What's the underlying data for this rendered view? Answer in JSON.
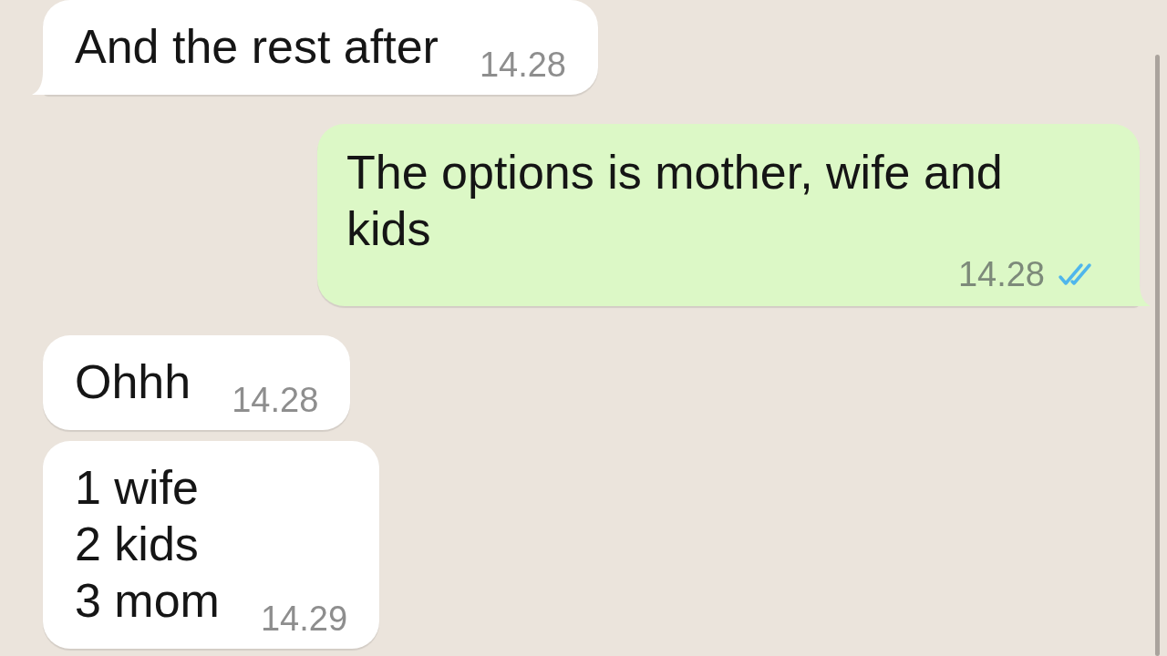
{
  "messages": [
    {
      "kind": "incoming",
      "text": "And the rest after",
      "time": "14.28",
      "tail": true
    },
    {
      "kind": "outgoing",
      "text": "The options is mother, wife and kids",
      "time": "14.28",
      "read": true,
      "tail": true
    },
    {
      "kind": "incoming",
      "text": "Ohhh",
      "time": "14.28",
      "tail": false
    },
    {
      "kind": "incoming",
      "text": "1 wife\n2 kids\n3 mom",
      "time": "14.29",
      "tail": false
    }
  ]
}
